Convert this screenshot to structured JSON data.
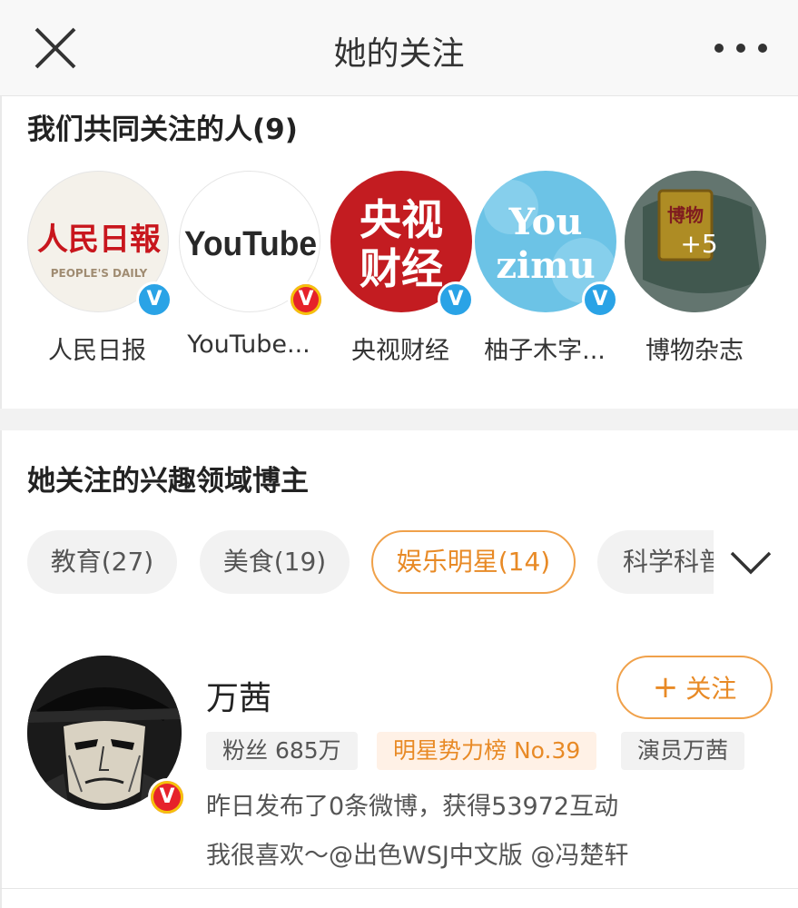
{
  "header": {
    "title": "她的关注"
  },
  "mutual": {
    "title": "我们共同关注的人(9)",
    "items": [
      {
        "name": "人民日报",
        "logo_main": "人民日報",
        "logo_sub": "PEOPLE'S DAILY",
        "badge": "V",
        "badge_color": "#2aa3e6"
      },
      {
        "name": "YouTube...",
        "logo_main": "YouTube",
        "badge": "V",
        "badge_color": "#e6222a"
      },
      {
        "name": "央视财经",
        "logo_line1": "央视",
        "logo_line2": "财经",
        "badge": "V",
        "badge_color": "#2aa3e6"
      },
      {
        "name": "柚子木字...",
        "logo_line1": "You",
        "logo_line2": "zimu",
        "badge": "V",
        "badge_color": "#2aa3e6"
      },
      {
        "name": "博物杂志",
        "logo_main": "博物",
        "more_count": "+5"
      }
    ]
  },
  "interest": {
    "title": "她关注的兴趣领域博主",
    "chips": [
      {
        "label": "教育(27)"
      },
      {
        "label": "美食(19)"
      },
      {
        "label": "娱乐明星(14)",
        "active": true
      },
      {
        "label": "科学科普"
      }
    ]
  },
  "user": {
    "name": "万茜",
    "follow_label": "关注",
    "tags": [
      "粉丝 685万",
      "明星势力榜 No.39",
      "演员万茜"
    ],
    "desc1": "昨日发布了0条微博，获得53972互动",
    "desc2": "我很喜欢～@出色WSJ中文版 @冯楚轩",
    "badge": "V"
  },
  "colors": {
    "accent": "#e88a26",
    "verified_blue": "#2aa3e6",
    "verified_gold": "#f5c20b",
    "verified_red": "#e6222a"
  }
}
